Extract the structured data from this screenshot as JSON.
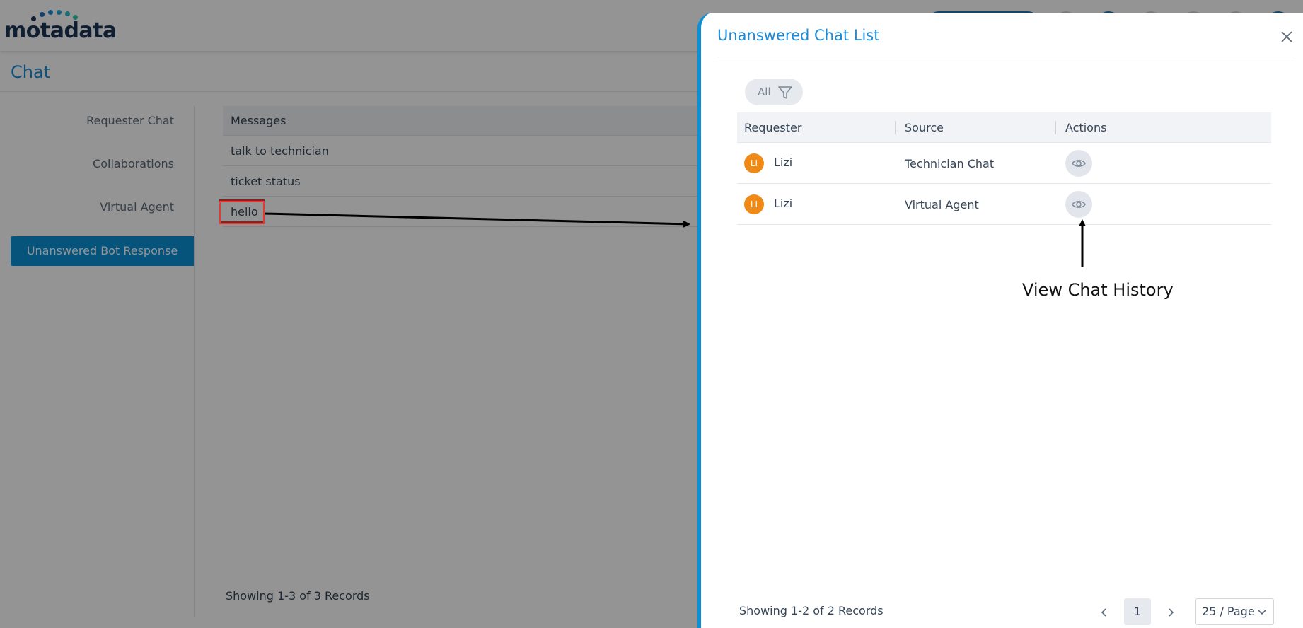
{
  "app": {
    "logo_text": "motadata",
    "page_title": "Chat"
  },
  "sidebar": {
    "items": [
      {
        "label": "Requester Chat"
      },
      {
        "label": "Collaborations"
      },
      {
        "label": "Virtual Agent"
      },
      {
        "label": "Unanswered Bot Response",
        "active": true
      }
    ]
  },
  "messages": {
    "header": "Messages",
    "rows": [
      "talk to technician",
      "ticket status",
      "hello"
    ],
    "footer": "Showing 1-3 of 3 Records"
  },
  "drawer": {
    "title": "Unanswered Chat List",
    "filter_label": "All",
    "columns": [
      "Requester",
      "Source",
      "Actions"
    ],
    "rows": [
      {
        "initials": "LI",
        "requester": "Lizi",
        "source": "Technician Chat"
      },
      {
        "initials": "LI",
        "requester": "Lizi",
        "source": "Virtual Agent"
      }
    ],
    "annotation": "View Chat History",
    "footer": "Showing 1-2 of 2 Records",
    "pagination": {
      "current_page": "1",
      "page_size": "25 / Page"
    }
  },
  "colors": {
    "accent": "#0b8fd6",
    "title": "#1c8ad6",
    "avatar": "#f08a16",
    "highlight": "#e53935"
  },
  "icons": {
    "close": "close-icon",
    "filter": "filter-icon",
    "view": "eye-icon",
    "prev": "chevron-left-icon",
    "next": "chevron-right-icon",
    "dropdown": "chevron-down-icon"
  }
}
